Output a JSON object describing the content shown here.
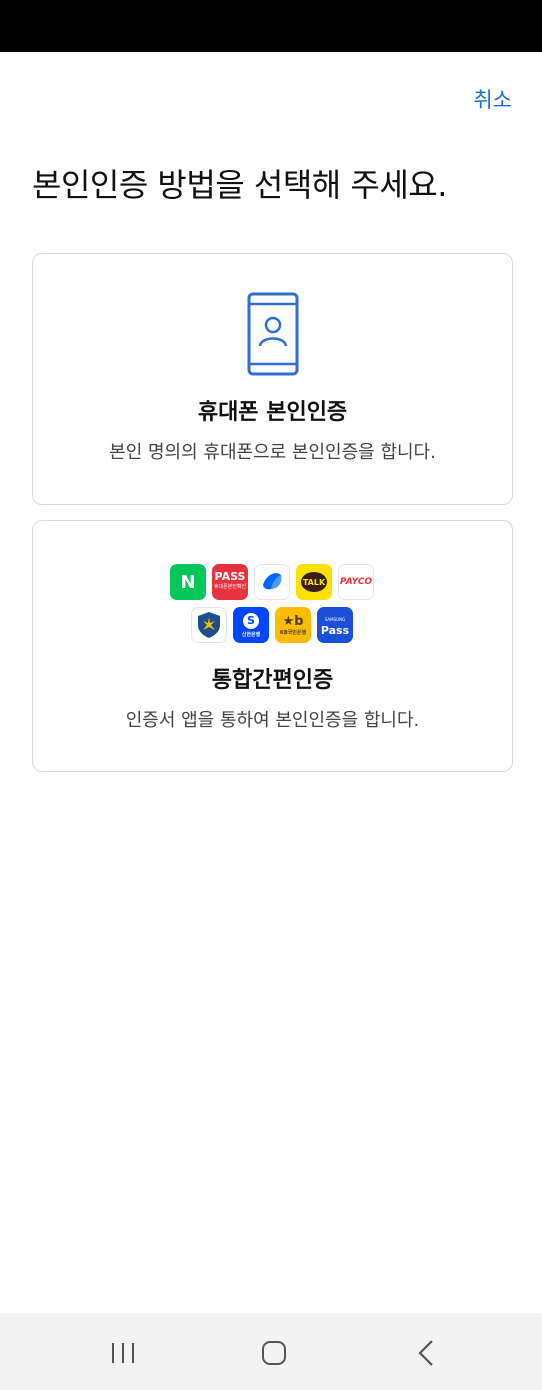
{
  "header": {
    "cancel_label": "취소"
  },
  "page": {
    "title": "본인인증 방법을 선택해 주세요."
  },
  "options": [
    {
      "icon": "phone-person-icon",
      "title": "휴대폰 본인인증",
      "description": "본인 명의의 휴대폰으로 본인인증을 합니다."
    },
    {
      "icons": [
        "naver-logo",
        "pass-logo",
        "toss-logo",
        "kakao-talk-logo",
        "payco-logo",
        "kftc-logo",
        "shinhan-bank-logo",
        "kb-bank-logo",
        "samsung-pass-logo"
      ],
      "title": "통합간편인증",
      "description": "인증서 앱을 통하여 본인인증을 합니다."
    }
  ],
  "logos": {
    "naver": "N",
    "pass": "PASS",
    "pass_sub": "휴대폰본인확인",
    "kakao": "TALK",
    "payco": "PAYCO",
    "shinhan": "신한은행",
    "shinhan_mark": "S",
    "kb_mark": "★b",
    "kb": "KB국민은행",
    "samsung_top": "SAMSUNG",
    "samsung": "Pass"
  },
  "colors": {
    "accent": "#1a6fd1",
    "naver": "#03c75a",
    "pass": "#e8323e",
    "kakao": "#fae100",
    "shinhan": "#0046ff",
    "kb": "#ffbc00",
    "samsung": "#1c4fd8"
  },
  "nav": {
    "buttons": [
      "recent-apps-icon",
      "home-icon",
      "back-icon"
    ]
  }
}
